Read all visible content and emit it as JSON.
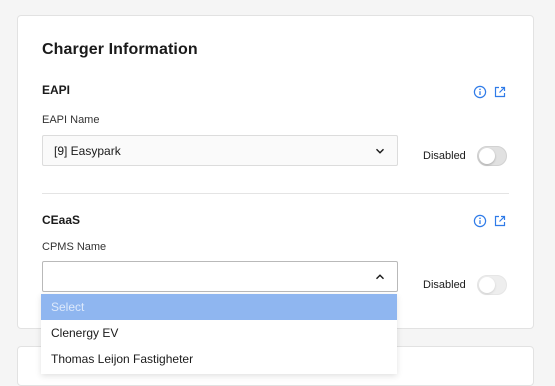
{
  "card_title": "Charger Information",
  "eapi": {
    "title": "EAPI",
    "field_label": "EAPI Name",
    "selected": "[9] Easypark",
    "toggle_label": "Disabled"
  },
  "ceaas": {
    "title": "CEaaS",
    "field_label": "CPMS Name",
    "selected": "",
    "toggle_label": "Disabled",
    "options": [
      "Select",
      "Clenergy EV",
      "Thomas Leijon Fastigheter"
    ]
  },
  "colors": {
    "accent": "#2f7be8",
    "option_highlight": "#8fb6f0"
  },
  "icons": [
    "info-icon",
    "external-link-icon"
  ]
}
